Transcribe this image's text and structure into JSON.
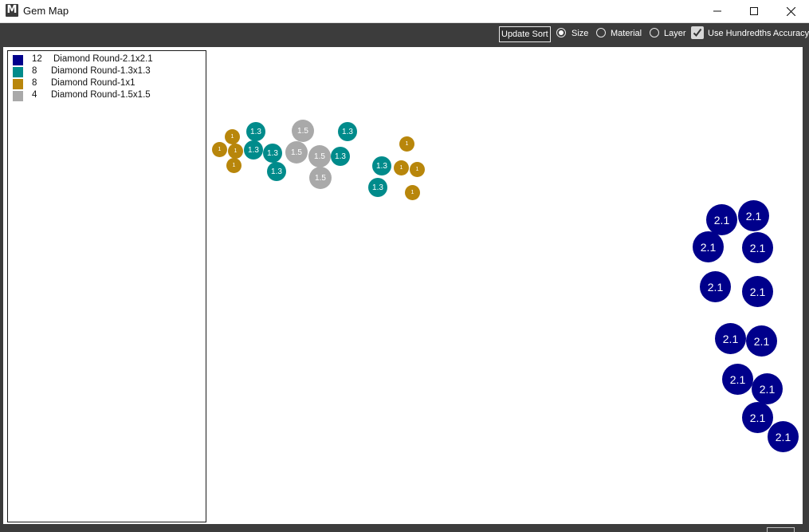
{
  "window": {
    "title": "Gem Map",
    "app_icon_letter": "M",
    "minimize_icon": "minimize-icon",
    "maximize_icon": "maximize-icon",
    "close_icon": "close-icon"
  },
  "toolbar": {
    "update_sort_label": "Update Sort",
    "sort_options": [
      {
        "label": "Size",
        "selected": true
      },
      {
        "label": "Material",
        "selected": false
      },
      {
        "label": "Layer",
        "selected": false
      }
    ],
    "hundredths_label": "Use Hundredths Accuracy",
    "hundredths_checked": true
  },
  "legend": [
    {
      "count": "12",
      "name": "Diamond Round-2.1x2.1",
      "color": "#00008b"
    },
    {
      "count": "8",
      "name": "Diamond Round-1.3x1.3",
      "color": "#008b8b"
    },
    {
      "count": "8",
      "name": "Diamond Round-1x1",
      "color": "#b8860b"
    },
    {
      "count": "4",
      "name": "Diamond Round-1.5x1.5",
      "color": "#a9a9a9"
    }
  ],
  "gem_types": {
    "2.1": {
      "label": "2.1",
      "color": "#00008b"
    },
    "1.3": {
      "label": "1.3",
      "color": "#008b8b"
    },
    "1": {
      "label": "1",
      "color": "#b8860b"
    },
    "1.5": {
      "label": "1.5",
      "color": "#a9a9a9"
    }
  }
}
